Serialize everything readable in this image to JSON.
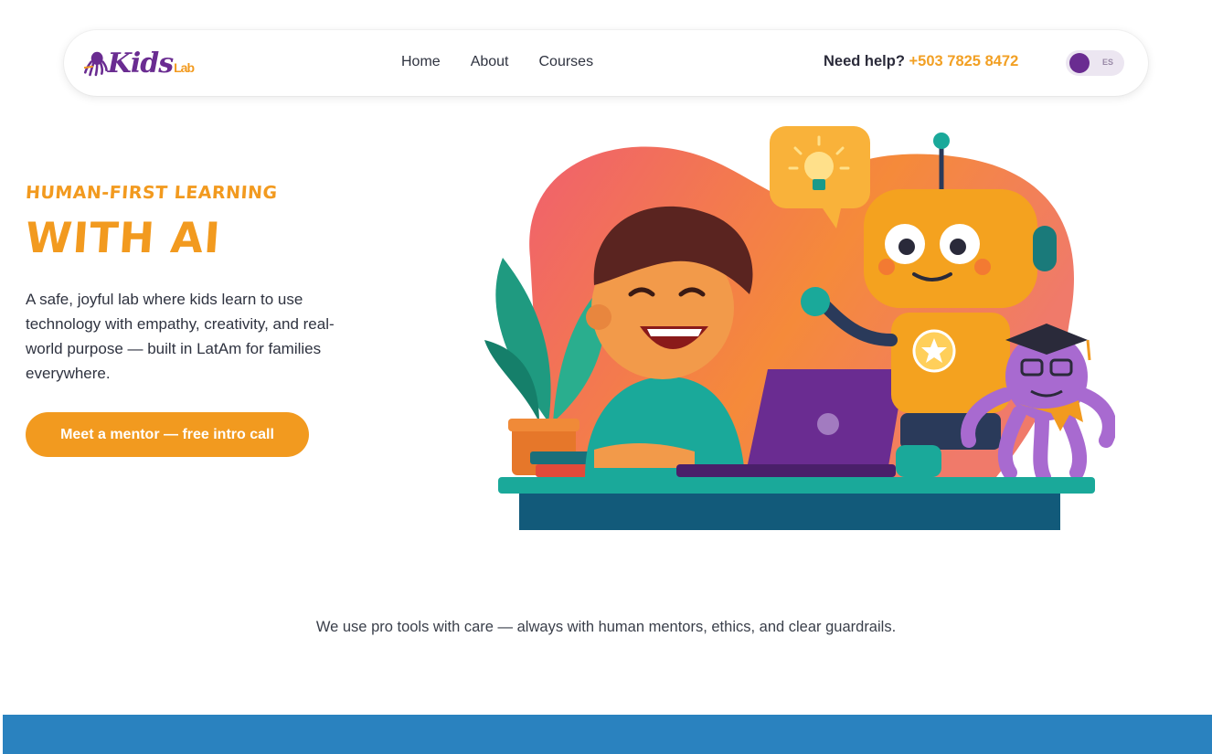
{
  "brand": {
    "logo_main": "Kids",
    "logo_sub": "Lab",
    "colors": {
      "purple": "#6a2c91",
      "orange": "#f29a1f",
      "blue": "#2a82bf"
    }
  },
  "nav": {
    "links": [
      "Home",
      "About",
      "Courses"
    ],
    "help_label": "Need help?",
    "help_phone": "+503 7825 8472",
    "lang_toggle": "ES"
  },
  "hero": {
    "kicker": "HUMAN-FIRST LEARNING",
    "title": "WITH AI",
    "text": "A safe, joyful lab where kids learn to use technology with empathy, creativity, and real-world purpose — built in LatAm for families everywhere.",
    "cta": "Meet a mentor — free intro call"
  },
  "tagline": "We use pro tools with care — always with human mentors, ethics, and clear guardrails.",
  "illustration": {
    "icons": [
      "kid-laptop-icon",
      "robot-icon",
      "octopus-graduate-icon",
      "lightbulb-icon",
      "plant-icon"
    ]
  }
}
